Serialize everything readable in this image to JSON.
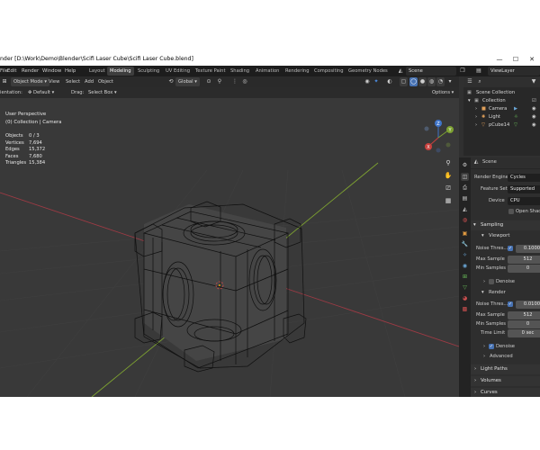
{
  "window": {
    "title": "nder [D:\\Work\\Demo\\Blender\\Scifi Laser Cube\\Scifi Laser Cube.blend]",
    "controls": [
      "—",
      "☐",
      "✕"
    ]
  },
  "menus": [
    "File",
    "Edit",
    "Render",
    "Window",
    "Help"
  ],
  "workspaces": [
    "Layout",
    "Modeling",
    "Sculpting",
    "UV Editing",
    "Texture Paint",
    "Shading",
    "Animation",
    "Rendering",
    "Compositing",
    "Geometry Nodes"
  ],
  "active_workspace": "Modeling",
  "scene_name": "Scene",
  "view_layer": "ViewLayer",
  "viewport_header": {
    "mode": "Object Mode",
    "menus": [
      "View",
      "Select",
      "Add",
      "Object"
    ],
    "transform": "Global",
    "options": "Options"
  },
  "tool_header": {
    "orientation_label": "ientation:",
    "orientation_value": "Default",
    "drag_label": "Drag:",
    "drag_value": "Select Box"
  },
  "viewport_overlay": {
    "view_name": "User Perspective",
    "collection": "(0) Collection | Camera",
    "stats": [
      {
        "label": "Objects",
        "value": "0 / 3"
      },
      {
        "label": "Vertices",
        "value": "7,694"
      },
      {
        "label": "Edges",
        "value": "15,372"
      },
      {
        "label": "Faces",
        "value": "7,680"
      },
      {
        "label": "Triangles",
        "value": "15,384"
      }
    ]
  },
  "gizmo": {
    "z": "Z",
    "y": "Y",
    "x": "X"
  },
  "outliner": {
    "root": "Scene Collection",
    "collection": "Collection",
    "items": [
      "Camera",
      "Light",
      "pCube14"
    ]
  },
  "properties": {
    "scene_label": "Scene",
    "render_engine_label": "Render Engine",
    "render_engine": "Cycles",
    "feature_set_label": "Feature Set",
    "feature_set": "Supported",
    "device_label": "Device",
    "device": "CPU",
    "open_shading_label": "Open Shadin",
    "sampling_label": "Sampling",
    "viewport_label": "Viewport",
    "viewport_noise_label": "Noise Thres...",
    "viewport_noise_value": "0.1000",
    "viewport_max_label": "Max Sample",
    "viewport_max_value": "512",
    "viewport_min_label": "Min Samples",
    "viewport_min_value": "0",
    "denoise_viewport_label": "Denoise",
    "render_label": "Render",
    "render_noise_label": "Noise Thres...",
    "render_noise_value": "0.0100",
    "render_max_label": "Max Sample",
    "render_max_value": "512",
    "render_min_label": "Min Samples",
    "render_min_value": "0",
    "time_limit_label": "Time Limit",
    "time_limit_value": "0 sec",
    "denoise_render_label": "Denoise",
    "advanced_label": "Advanced",
    "light_paths_label": "Light Paths",
    "volumes_label": "Volumes",
    "curves_label": "Curves"
  },
  "colors": {
    "accent": "#4772b3",
    "x_axis": "#9c3a44",
    "y_axis": "#7da131",
    "z_axis": "#3f74c9"
  }
}
